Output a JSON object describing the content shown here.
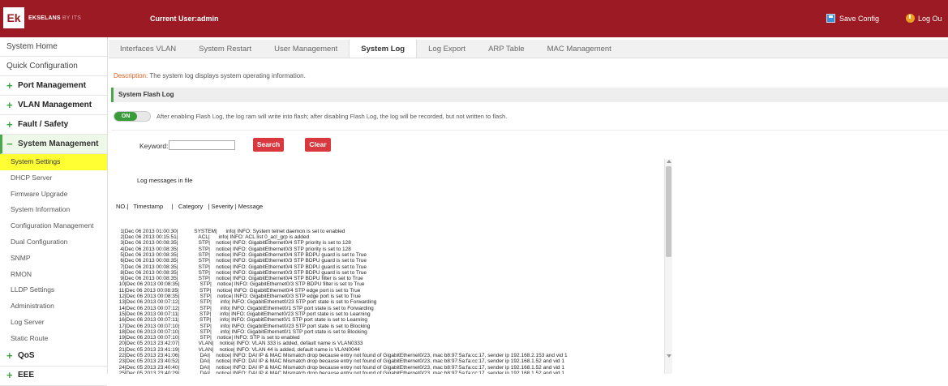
{
  "header": {
    "logo_mark": "Ek",
    "logo_text": "EKSELANS",
    "logo_sub": "BY ITS",
    "current_user": "Current User:admin",
    "save_config": "Save Config",
    "logout": "Log Ou"
  },
  "sidebar": {
    "top_items": [
      "System Home",
      "Quick Configuration"
    ],
    "groups": {
      "port": "Port Management",
      "vlan": "VLAN Management",
      "fault": "Fault / Safety",
      "system": "System Management",
      "qos": "QoS",
      "eee": "EEE"
    },
    "system_items": [
      "System Settings",
      "DHCP Server",
      "Firmware Upgrade",
      "System Information",
      "Configuration Management",
      "Dual Configuration",
      "SNMP",
      "RMON",
      "LLDP Settings",
      "Administration",
      "Log Server",
      "Static Route"
    ]
  },
  "tabs": [
    "Interfaces VLAN",
    "System Restart",
    "User Management",
    "System Log",
    "Log Export",
    "ARP Table",
    "MAC Management"
  ],
  "description": {
    "label": "Description:",
    "text": "The system log displays system operating information."
  },
  "section_title": "System Flash Log",
  "flash_log": {
    "toggle_label": "ON",
    "toggle_state": "on",
    "text": "After enabling Flash Log, the log ram will write into flash; after disabling Flash Log, the log will be recorded, but not written to flash."
  },
  "search": {
    "keyword_label": "Keyword:",
    "keyword_value": "",
    "search_button": "Search",
    "clear_button": "Clear"
  },
  "log": {
    "title": "Log messages in file",
    "header": "NO.|   Timestamp     |   Category   | Severity | Message",
    "lines": [
      "   1|Dec 06 2013 01:00:30|           SYSTEM|      info| INFO: System telnet daemon is set to enabled",
      "   2|Dec 06 2013 00:15:51|              ACL|      info| INFO: ACL list 0_acl_grp is added",
      "   3|Dec 06 2013 00:08:35|              STP|    notice| INFO: GigabitEthernet0/4 STP priority is set to 128",
      "   4|Dec 06 2013 00:08:35|              STP|    notice| INFO: GigabitEthernet0/3 STP priority is set to 128",
      "   5|Dec 06 2013 00:08:35|              STP|    notice| INFO: GigabitEthernet0/4 STP BDPU guard is set to True",
      "   6|Dec 06 2013 00:08:35|              STP|    notice| INFO: GigabitEthernet0/3 STP BDPU guard is set to True",
      "   7|Dec 06 2013 00:08:35|              STP|    notice| INFO: GigabitEthernet0/4 STP BDPU guard is set to True",
      "   8|Dec 06 2013 00:08:35|              STP|    notice| INFO: GigabitEthernet0/3 STP BDPU guard is set to True",
      "   9|Dec 06 2013 00:08:35|              STP|    notice| INFO: GigabitEthernet0/4 STP BDPU filter is set to True",
      "  10|Dec 06 2013 00:08:35|              STP|    notice| INFO: GigabitEthernet0/3 STP BDPU filter is set to True",
      "  11|Dec 06 2013 00:08:35|              STP|    notice| INFO: GigabitEthernet0/4 STP edge port is set to True",
      "  12|Dec 06 2013 00:08:35|              STP|    notice| INFO: GigabitEthernet0/3 STP edge port is set to True",
      "  13|Dec 06 2013 00:07:12|              STP|      info| INFO: GigabitEthernet0/23 STP port state is set to Forwarding",
      "  14|Dec 06 2013 00:07:12|              STP|      info| INFO: GigabitEthernet0/1 STP port state is set to Forwarding",
      "  15|Dec 06 2013 00:07:11|              STP|      info| INFO: GigabitEthernet0/23 STP port state is set to Learning",
      "  16|Dec 06 2013 00:07:11|              STP|      info| INFO: GigabitEthernet0/1 STP port state is set to Learning",
      "  17|Dec 06 2013 00:07:10|              STP|      info| INFO: GigabitEthernet0/23 STP port state is set to Blocking",
      "  18|Dec 06 2013 00:07:10|              STP|      info| INFO: GigabitEthernet0/1 STP port state is set to Blocking",
      "  19|Dec 06 2013 00:07:10|              STP|    notice| INFO: STP is set to enabled",
      "  20|Dec 05 2013 23:42:07|             VLAN|    notice| INFO: VLAN 333 is added, default name is VLAN0333",
      "  21|Dec 05 2013 23:41:19|             VLAN|    notice| INFO: VLAN 44 is added, default name is VLAN0044",
      "  22|Dec 05 2013 23:41:06|              DAI|    notice| INFO: DAI IP & MAC Mismatch drop because entry not found of GigabitEthernet0/23, mac b8:97:5a:fa:cc:17, sender ip 192.168.2.153 and vid 1",
      "  23|Dec 05 2013 23:40:52|              DAI|    notice| INFO: DAI IP & MAC Mismatch drop because entry not found of GigabitEthernet0/23, mac b8:97:5a:fa:cc:17, sender ip 192.168.1.52 and vid 1",
      "  24|Dec 05 2013 23:40:40|              DAI|    notice| INFO: DAI IP & MAC Mismatch drop because entry not found of GigabitEthernet0/23, mac b8:97:5a:fa:cc:17, sender ip 192.168.1.52 and vid 1",
      "  25|Dec 05 2013 23:40:29|              DAI|    notice| INFO: DAI IP & MAC Mismatch drop because entry not found of GigabitEthernet0/23, mac b8:97:5a:fa:cc:17, sender ip 192.168.1.52 and vid 1"
    ]
  },
  "colors": {
    "header_bg": "#9b1a23",
    "accent_green": "#4aa84a",
    "button_red": "#d9383f",
    "selected_item": "#ffff33",
    "description_label": "#e06020"
  },
  "icons": {
    "save": "floppy-disk-icon",
    "logout": "power-icon",
    "expand": "plus-icon",
    "collapse": "minus-icon"
  }
}
